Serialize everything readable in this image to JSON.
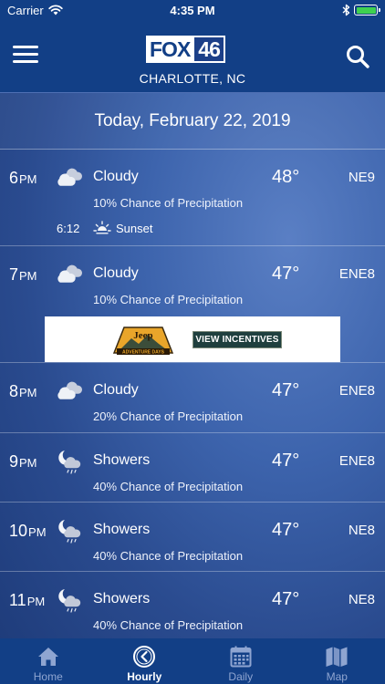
{
  "status_bar": {
    "carrier": "Carrier",
    "time": "4:35 PM",
    "battery_level": 1.0,
    "battery_color": "#3ed14f"
  },
  "header": {
    "logo_fox": "FOX",
    "logo_channel": "46",
    "location": "CHARLOTTE, NC"
  },
  "date_label": "Today, February 22, 2019",
  "hours": [
    {
      "hour": "6",
      "ampm": "PM",
      "icon": "cloudy-icon",
      "condition": "Cloudy",
      "temp": "48°",
      "wind": "NE9",
      "precip": "10% Chance of Precipitation",
      "sunset_time": "6:12",
      "sunset_label": "Sunset"
    },
    {
      "hour": "7",
      "ampm": "PM",
      "icon": "cloudy-icon",
      "condition": "Cloudy",
      "temp": "47°",
      "wind": "ENE8",
      "precip": "10% Chance of Precipitation"
    },
    {
      "hour": "8",
      "ampm": "PM",
      "icon": "cloudy-icon",
      "condition": "Cloudy",
      "temp": "47°",
      "wind": "ENE8",
      "precip": "20% Chance of Precipitation"
    },
    {
      "hour": "9",
      "ampm": "PM",
      "icon": "night-showers-icon",
      "condition": "Showers",
      "temp": "47°",
      "wind": "ENE8",
      "precip": "40% Chance of Precipitation"
    },
    {
      "hour": "10",
      "ampm": "PM",
      "icon": "night-showers-icon",
      "condition": "Showers",
      "temp": "47°",
      "wind": "NE8",
      "precip": "40% Chance of Precipitation"
    },
    {
      "hour": "11",
      "ampm": "PM",
      "icon": "night-showers-icon",
      "condition": "Showers",
      "temp": "47°",
      "wind": "NE8",
      "precip": "40% Chance of Precipitation"
    }
  ],
  "ad": {
    "brand": "Jeep",
    "tagline": "ADVENTURE DAYS",
    "cta": "VIEW INCENTIVES"
  },
  "tabs": [
    {
      "label": "Home",
      "icon": "home-icon"
    },
    {
      "label": "Hourly",
      "icon": "clock-icon",
      "active": true
    },
    {
      "label": "Daily",
      "icon": "calendar-icon"
    },
    {
      "label": "Map",
      "icon": "map-icon"
    }
  ],
  "colors": {
    "bar_bg": "#123f86",
    "tab_inactive": "#8fa5d1",
    "tab_active": "#ffffff"
  }
}
